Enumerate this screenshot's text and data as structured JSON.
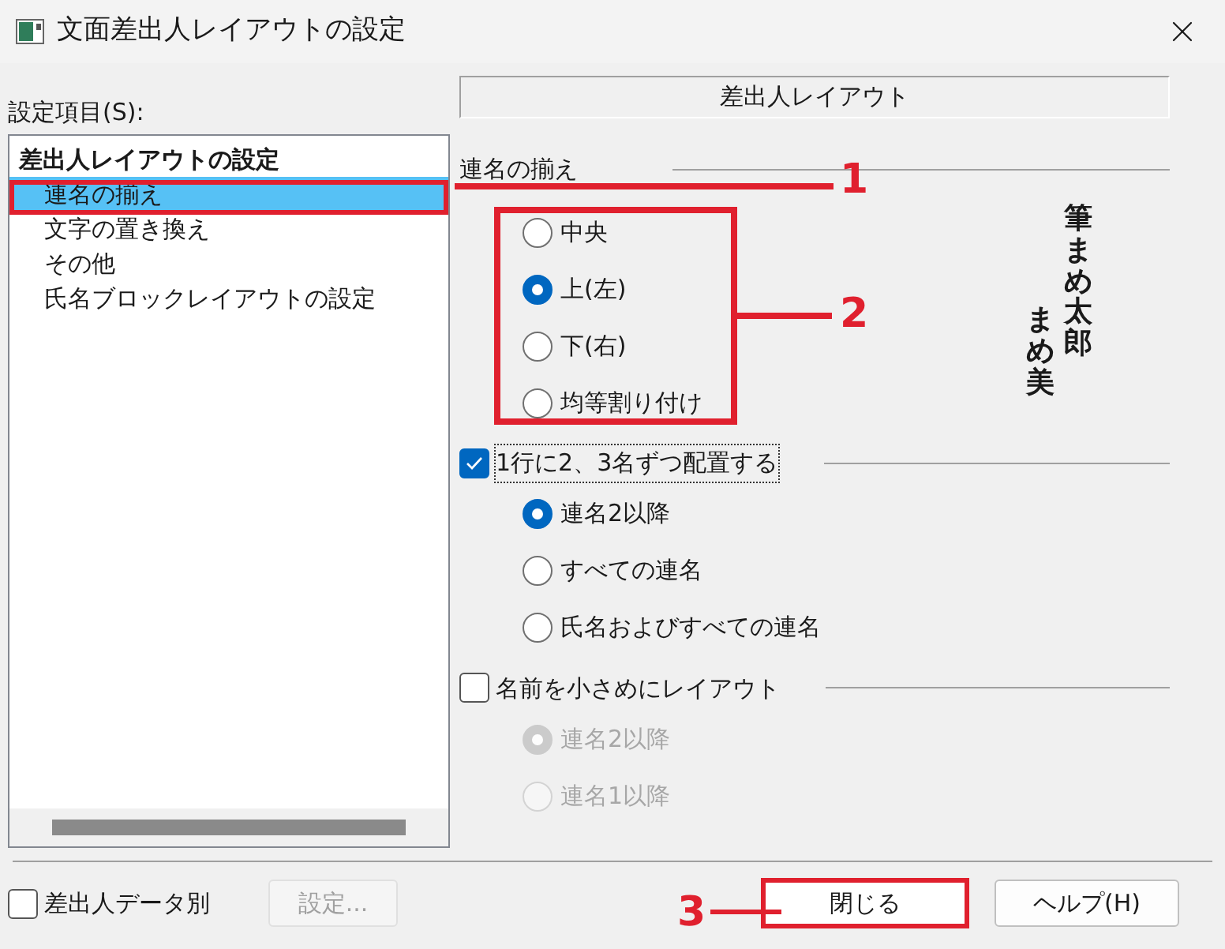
{
  "window": {
    "title": "文面差出人レイアウトの設定"
  },
  "settings_list": {
    "label": "設定項目(S):",
    "items": [
      {
        "label": "差出人レイアウトの設定",
        "selected": false,
        "children": [
          {
            "label": "連名の揃え",
            "selected": true
          },
          {
            "label": "文字の置き換え",
            "selected": false
          },
          {
            "label": "その他",
            "selected": false
          },
          {
            "label": "氏名ブロックレイアウトの設定",
            "selected": false
          }
        ]
      }
    ]
  },
  "panel_header": "差出人レイアウト",
  "alignment_group": {
    "title": "連名の揃え",
    "options": [
      {
        "label": "中央",
        "selected": false
      },
      {
        "label": "上(左)",
        "selected": true
      },
      {
        "label": "下(右)",
        "selected": false
      },
      {
        "label": "均等割り付け",
        "selected": false
      }
    ]
  },
  "preview": {
    "columns": [
      "まめ美",
      "筆まめ太郎"
    ]
  },
  "per_row_group": {
    "label": "1行に2、3名ずつ配置する",
    "checked": true,
    "disabled": false,
    "options": [
      {
        "label": "連名2以降",
        "selected": true
      },
      {
        "label": "すべての連名",
        "selected": false
      },
      {
        "label": "氏名およびすべての連名",
        "selected": false
      }
    ]
  },
  "smaller_group": {
    "label": "名前を小さめにレイアウト",
    "checked": false,
    "disabled": true,
    "options": [
      {
        "label": "連名2以降",
        "selected": true
      },
      {
        "label": "連名1以降",
        "selected": false
      }
    ]
  },
  "footer": {
    "per_sender": {
      "label": "差出人データ別",
      "checked": false
    },
    "settings_button": {
      "label": "設定...",
      "disabled": true
    },
    "close_button": "閉じる",
    "help_button": "ヘルプ(H)"
  },
  "annotations": [
    "1",
    "2",
    "3"
  ]
}
